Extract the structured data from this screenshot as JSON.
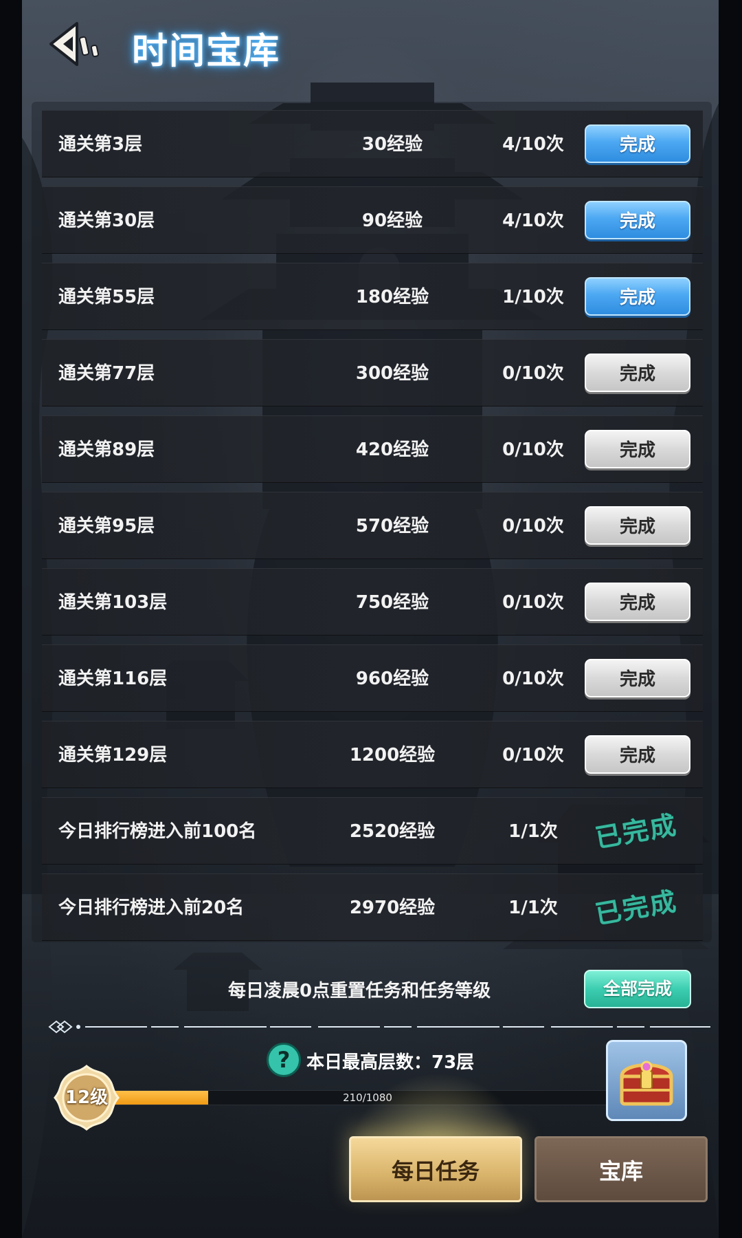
{
  "header": {
    "title": "时间宝库"
  },
  "tasks": [
    {
      "name": "通关第3层",
      "exp": "30经验",
      "count": "4/10次",
      "status": "完成",
      "state": "available"
    },
    {
      "name": "通关第30层",
      "exp": "90经验",
      "count": "4/10次",
      "status": "完成",
      "state": "available"
    },
    {
      "name": "通关第55层",
      "exp": "180经验",
      "count": "1/10次",
      "status": "完成",
      "state": "available"
    },
    {
      "name": "通关第77层",
      "exp": "300经验",
      "count": "0/10次",
      "status": "完成",
      "state": "locked"
    },
    {
      "name": "通关第89层",
      "exp": "420经验",
      "count": "0/10次",
      "status": "完成",
      "state": "locked"
    },
    {
      "name": "通关第95层",
      "exp": "570经验",
      "count": "0/10次",
      "status": "完成",
      "state": "locked"
    },
    {
      "name": "通关第103层",
      "exp": "750经验",
      "count": "0/10次",
      "status": "完成",
      "state": "locked"
    },
    {
      "name": "通关第116层",
      "exp": "960经验",
      "count": "0/10次",
      "status": "完成",
      "state": "locked"
    },
    {
      "name": "通关第129层",
      "exp": "1200经验",
      "count": "0/10次",
      "status": "完成",
      "state": "locked"
    },
    {
      "name": "今日排行榜进入前100名",
      "exp": "2520经验",
      "count": "1/1次",
      "status": "已完成",
      "state": "done"
    },
    {
      "name": "今日排行榜进入前20名",
      "exp": "2970经验",
      "count": "1/1次",
      "status": "已完成",
      "state": "done"
    }
  ],
  "footer": {
    "reset_note": "每日凌晨0点重置任务和任务等级",
    "complete_all": "全部完成",
    "highest_floor": "本日最高层数：73层",
    "level": "12级",
    "progress_text": "210/1080",
    "progress_value": 210,
    "progress_max": 1080
  },
  "tabs": {
    "daily": "每日任务",
    "vault": "宝库"
  },
  "icons": {
    "back": "back-arrow-icon",
    "help": "question-icon",
    "chest": "treasure-chest-icon",
    "level_badge": "level-badge-icon"
  },
  "colors": {
    "available_button": "#4ca8f2",
    "locked_button": "#d9d9d9",
    "done_stamp": "#37b89e",
    "complete_all": "#3ccdb0",
    "progress_fill": "#f09a14",
    "title_glow": "#4fb6ff"
  }
}
